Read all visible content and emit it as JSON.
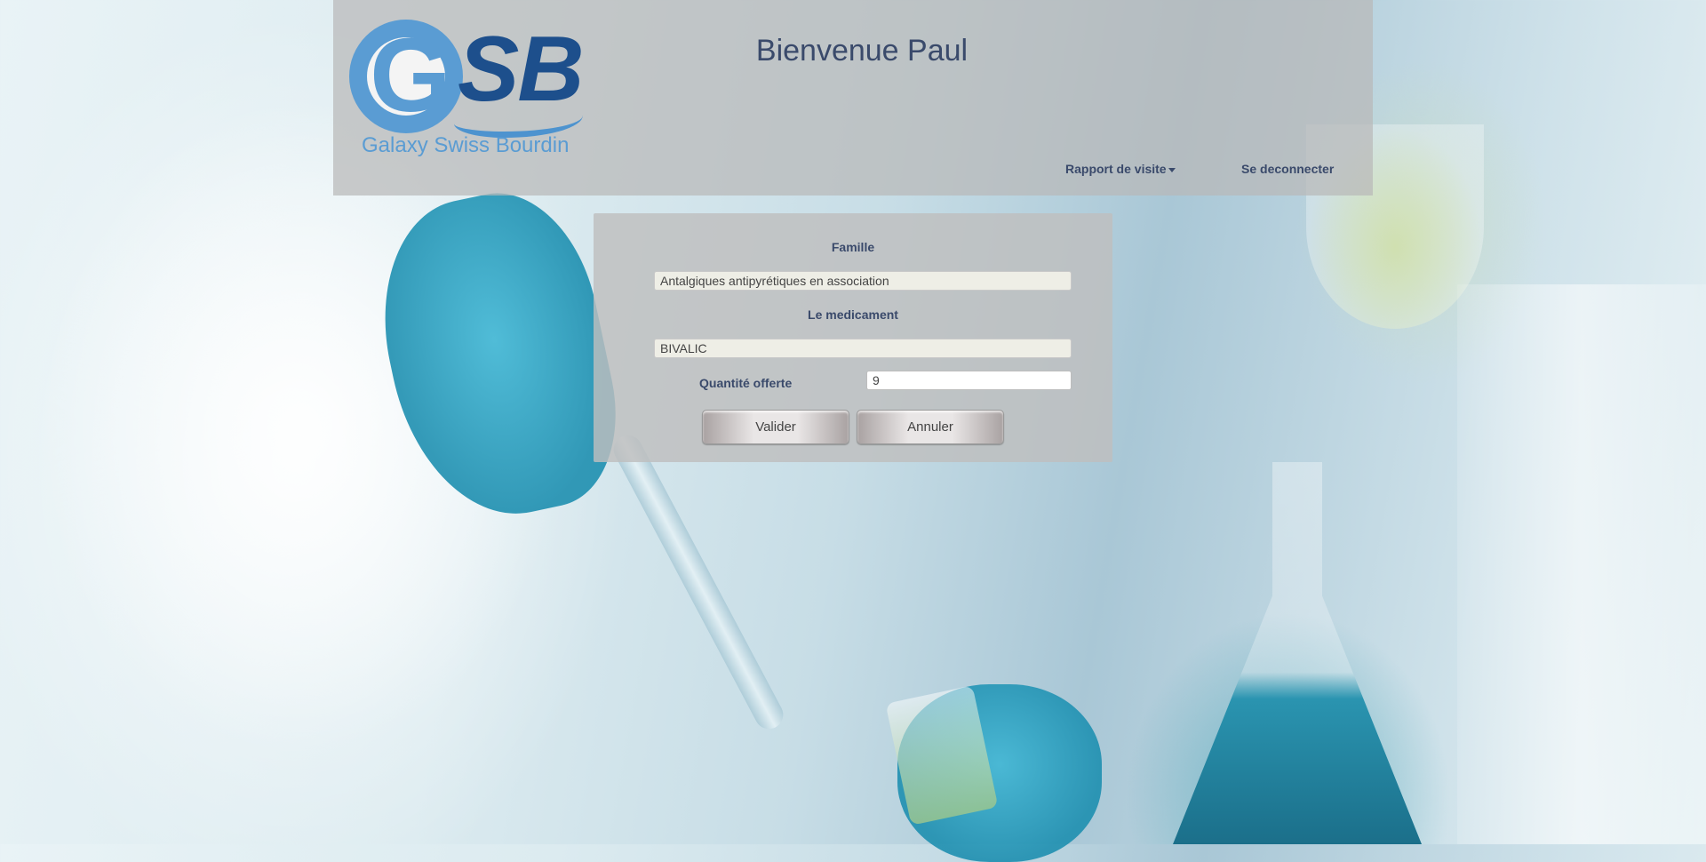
{
  "header": {
    "logo_letters_g": "G",
    "logo_letters_sb": "SB",
    "logo_tagline": "Galaxy Swiss Bourdin",
    "welcome": "Bienvenue Paul",
    "nav": {
      "rapport_label": "Rapport de visite",
      "logout_label": "Se deconnecter"
    }
  },
  "form": {
    "famille_label": "Famille",
    "famille_value": "Antalgiques antipyrétiques en association",
    "medicament_label": "Le medicament",
    "medicament_value": "BIVALIC",
    "quantite_label": "Quantité offerte",
    "quantite_value": "9",
    "valider_label": "Valider",
    "annuler_label": "Annuler"
  },
  "colors": {
    "logo_light_blue": "#5a9cd3",
    "logo_dark_blue": "#1d4f8c",
    "text_navy": "#3a4a6b"
  }
}
